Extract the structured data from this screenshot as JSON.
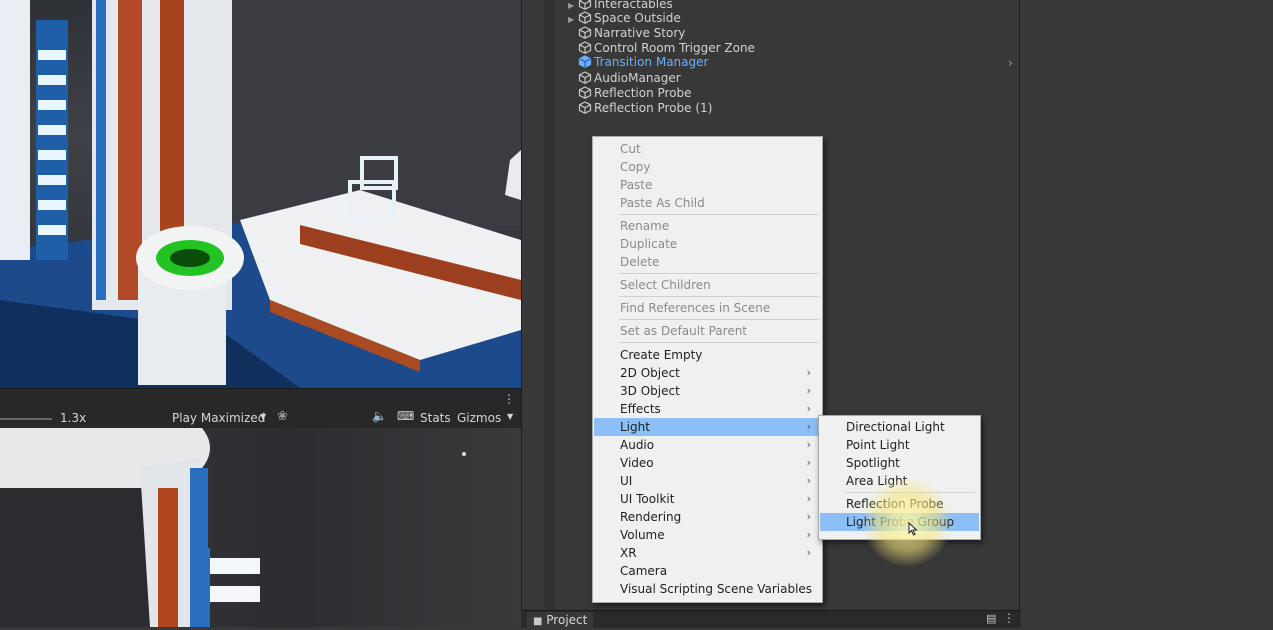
{
  "hierarchy": {
    "items": [
      {
        "label": "Interactables",
        "expandable": true,
        "selected": false
      },
      {
        "label": "Space Outside",
        "expandable": true,
        "selected": false
      },
      {
        "label": "Narrative Story",
        "expandable": false,
        "selected": false
      },
      {
        "label": "Control Room Trigger Zone",
        "expandable": false,
        "selected": false
      },
      {
        "label": "Transition Manager",
        "expandable": false,
        "selected": true
      },
      {
        "label": "AudioManager",
        "expandable": false,
        "selected": false
      },
      {
        "label": "Reflection Probe",
        "expandable": false,
        "selected": false
      },
      {
        "label": "Reflection Probe (1)",
        "expandable": false,
        "selected": false
      }
    ]
  },
  "game_toolbar": {
    "zoom": "1.3x",
    "play_mode": "Play Maximized",
    "stats": "Stats",
    "gizmos": "Gizmos"
  },
  "context_menu": {
    "items": [
      {
        "label": "Cut",
        "enabled": false
      },
      {
        "label": "Copy",
        "enabled": false
      },
      {
        "label": "Paste",
        "enabled": false
      },
      {
        "label": "Paste As Child",
        "enabled": false
      },
      {
        "label": "Rename",
        "enabled": false
      },
      {
        "label": "Duplicate",
        "enabled": false
      },
      {
        "label": "Delete",
        "enabled": false
      },
      {
        "label": "Select Children",
        "enabled": false
      },
      {
        "label": "Find References in Scene",
        "enabled": false
      },
      {
        "label": "Set as Default Parent",
        "enabled": false
      },
      {
        "label": "Create Empty",
        "enabled": true
      },
      {
        "label": "2D Object",
        "enabled": true,
        "submenu": true
      },
      {
        "label": "3D Object",
        "enabled": true,
        "submenu": true
      },
      {
        "label": "Effects",
        "enabled": true,
        "submenu": true
      },
      {
        "label": "Light",
        "enabled": true,
        "submenu": true,
        "highlighted": true
      },
      {
        "label": "Audio",
        "enabled": true,
        "submenu": true
      },
      {
        "label": "Video",
        "enabled": true,
        "submenu": true
      },
      {
        "label": "UI",
        "enabled": true,
        "submenu": true
      },
      {
        "label": "UI Toolkit",
        "enabled": true,
        "submenu": true
      },
      {
        "label": "Rendering",
        "enabled": true,
        "submenu": true
      },
      {
        "label": "Volume",
        "enabled": true,
        "submenu": true
      },
      {
        "label": "XR",
        "enabled": true,
        "submenu": true
      },
      {
        "label": "Camera",
        "enabled": true
      },
      {
        "label": "Visual Scripting Scene Variables",
        "enabled": true
      }
    ]
  },
  "light_submenu": {
    "items": [
      {
        "label": "Directional Light"
      },
      {
        "label": "Point Light"
      },
      {
        "label": "Spotlight"
      },
      {
        "label": "Area Light"
      },
      {
        "label": "Reflection Probe"
      },
      {
        "label": "Light Probe Group",
        "highlighted": true
      }
    ]
  },
  "project_tab": {
    "label": "Project"
  },
  "colors": {
    "selection_text": "#6ab0ff",
    "menu_highlight": "#8cbff5",
    "menu_bg": "#f0f0f0",
    "panel_bg": "#383838"
  }
}
